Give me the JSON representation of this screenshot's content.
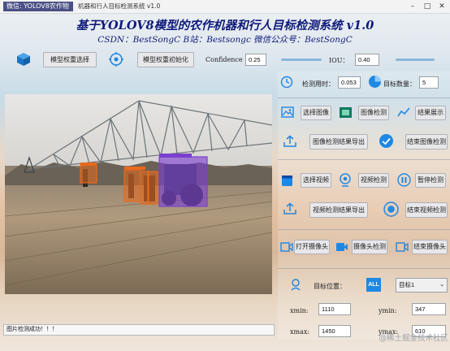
{
  "window": {
    "badge_text": "微信: YOLOV8农作物",
    "title": "机器和行人目标检测系统 v1.0"
  },
  "header": {
    "title": "基于YOLOV8模型的农作机器和行人目标检测系统 v1.0",
    "subtitle": "CSDN：BestSongC   B站：Bestsongc   微信公众号：BestSongC"
  },
  "toolbar": {
    "select_weights_label": "模型权重选择",
    "init_weights_label": "模型权重初始化",
    "confidence_label": "Confidence",
    "confidence_value": "0.25",
    "iou_label": "IOU：",
    "iou_value": "0.40"
  },
  "stats": {
    "time_label": "检测用时：",
    "time_value": "0.053",
    "count_label": "目标数量：",
    "count_value": "5"
  },
  "image_section": {
    "select_label": "选择图像",
    "detect_label": "图像检测",
    "show_label": "结果展示",
    "export_label": "图像检测结果导出",
    "end_label": "结束图像检测"
  },
  "video_section": {
    "select_label": "选择视频",
    "detect_label": "视频检测",
    "pause_label": "暂停检测",
    "export_label": "视频检测结果导出",
    "end_label": "结束视频检测"
  },
  "camera_section": {
    "open_label": "打开摄像头",
    "detect_label": "摄像头检测",
    "end_label": "结束摄像头"
  },
  "target": {
    "position_label": "目标位置：",
    "selected": "目标1",
    "xmin_label": "xmin:",
    "xmin_value": "1110",
    "ymin_label": "ymin:",
    "ymin_value": "347",
    "xmax_label": "xmax:",
    "xmax_value": "1450",
    "ymax_label": "ymax:",
    "ymax_value": "610"
  },
  "status_text": "图片检测成功！！！",
  "watermark": "@稀土掘金技术社区",
  "colors": {
    "title": "#0e1a7b",
    "accent_blue": "#1e88e5",
    "detection_orange": "#e8691b",
    "detection_purple": "#7b3fd0"
  }
}
